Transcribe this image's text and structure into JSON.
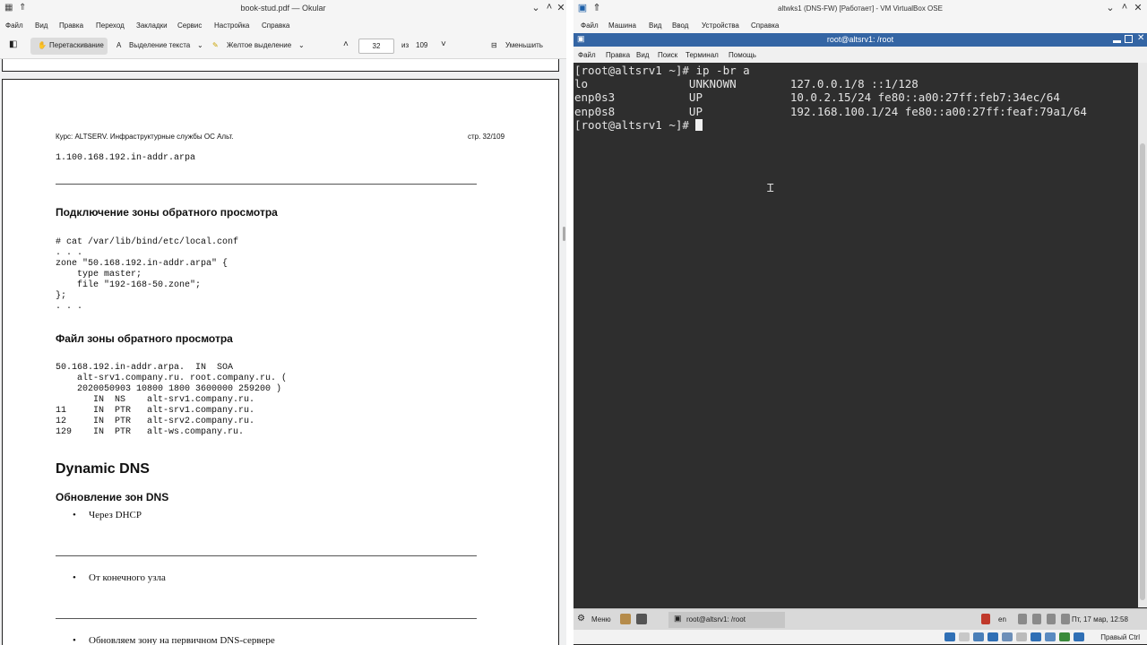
{
  "okular": {
    "title": "book-stud.pdf — Okular",
    "menu": [
      "Файл",
      "Вид",
      "Правка",
      "Переход",
      "Закладки",
      "Сервис",
      "Настройка",
      "Справка"
    ],
    "toolbar": {
      "drag": "Перетаскивание",
      "text_select": "Выделение текста",
      "highlight": "Желтое выделение",
      "page_current": "32",
      "page_of": "из",
      "page_total": "109",
      "zoom_out": "Уменьшить"
    },
    "document": {
      "header_left": "Курс: ALTSERV. Инфраструктурные службы ОС Альт.",
      "header_right": "стр. 32/109",
      "top_line": "1.100.168.192.in-addr.arpa",
      "section1_title": "Подключение зоны обратного просмотра",
      "code1": [
        "# cat /var/lib/bind/etc/local.conf",
        ". . .",
        "zone \"50.168.192.in-addr.arpa\" {",
        "    type master;",
        "    file \"192-168-50.zone\";",
        "};",
        ". . ."
      ],
      "section2_title": "Файл зоны обратного просмотра",
      "code2": [
        "50.168.192.in-addr.arpa.  IN  SOA",
        "    alt-srv1.company.ru. root.company.ru. (",
        "    2020050903 10800 1800 3600000 259200 )",
        "       IN  NS    alt-srv1.company.ru.",
        "11     IN  PTR   alt-srv1.company.ru.",
        "12     IN  PTR   alt-srv2.company.ru.",
        "129    IN  PTR   alt-ws.company.ru."
      ],
      "heading_dynamic": "Dynamic DNS",
      "subheading": "Обновление зон DNS",
      "bullets": [
        "Через DHCP",
        "От конечного узла",
        "Обновляем зону на первичном DNS-сервере"
      ],
      "bullet_glyph": "•"
    }
  },
  "vbox": {
    "title": "altwks1 (DNS-FW) [Работает] - VM VirtualBox OSE",
    "menu": [
      "Файл",
      "Машина",
      "Вид",
      "Ввод",
      "Устройства",
      "Справка"
    ],
    "status_hostkey": "Правый Ctrl"
  },
  "terminal": {
    "title": "root@altsrv1: /root",
    "menu": [
      "Файл",
      "Правка",
      "Вид",
      "Поиск",
      "Терминал",
      "Помощь"
    ],
    "lines": [
      "[root@altsrv1 ~]# ip -br a",
      "lo               UNKNOWN        127.0.0.1/8 ::1/128",
      "enp0s3           UP             10.0.2.15/24 fe80::a00:27ff:feb7:34ec/64",
      "enp0s8           UP             192.168.100.1/24 fe80::a00:27ff:feaf:79a1/64"
    ],
    "prompt": "[root@altsrv1 ~]# "
  },
  "guest_taskbar": {
    "menu_label": "Меню",
    "task_label": "root@altsrv1: /root",
    "lang": "en",
    "clock": "Пт, 17 мар, 12:58"
  },
  "colors": {
    "terminal_bg": "#2e2e2e",
    "terminal_titlebar": "#3465a4",
    "terminal_fg": "#e4e4e4"
  }
}
